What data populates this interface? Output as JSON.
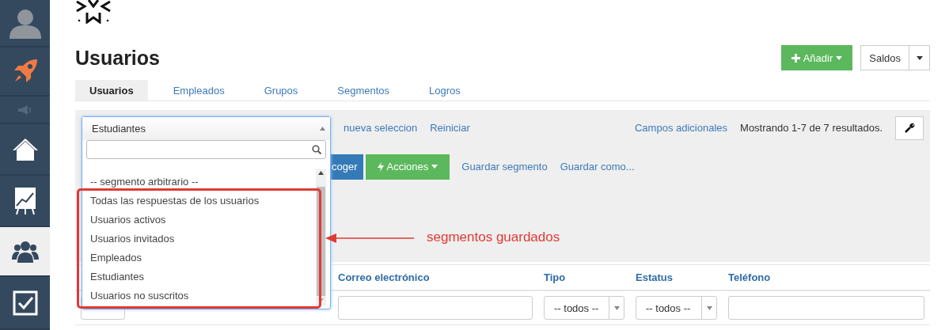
{
  "sidebar": {
    "items": [
      {
        "kind": "avatar",
        "selected": false
      },
      {
        "kind": "rocket",
        "selected": false
      },
      {
        "kind": "megaphone",
        "selected": false
      },
      {
        "kind": "home",
        "selected": false
      },
      {
        "kind": "chart",
        "selected": false
      },
      {
        "kind": "users",
        "selected": true
      },
      {
        "kind": "checklist",
        "selected": false
      }
    ]
  },
  "page": {
    "title": "Usuarios",
    "add_button": "Añadir",
    "saldos_button": "Saldos"
  },
  "tabs": [
    {
      "label": "Usuarios",
      "selected": true
    },
    {
      "label": "Empleados",
      "selected": false
    },
    {
      "label": "Grupos",
      "selected": false
    },
    {
      "label": "Segmentos",
      "selected": false
    },
    {
      "label": "Logros",
      "selected": false
    }
  ],
  "filter_panel": {
    "segment_select": {
      "value": "Estudiantes",
      "options": [
        "-- segmento arbitrario --",
        "Todas las respuestas de los usuarios",
        "Usuarios activos",
        "Usuarios invitados",
        "Empleados",
        "Estudiantes",
        "Usuarios no suscritos"
      ]
    },
    "links": [
      "nueva seleccion",
      "Reiniciar"
    ],
    "extra_fields_link": "Campos adicionales",
    "results": "Mostrando 1-7 de 7 resultados.",
    "pick_button": "coger",
    "actions_button": "Acciones",
    "save_links": [
      "Guardar segmento",
      "Guardar como..."
    ]
  },
  "annotation": {
    "label": "segmentos guardados"
  },
  "table": {
    "columns": [
      "Correo electrónico",
      "Tipo",
      "Estatus",
      "Teléfono"
    ],
    "filters": [
      {
        "kind": "text"
      },
      {
        "kind": "select",
        "value": "-- todos --"
      },
      {
        "kind": "select",
        "value": "-- todos --"
      },
      {
        "kind": "text"
      }
    ]
  }
}
